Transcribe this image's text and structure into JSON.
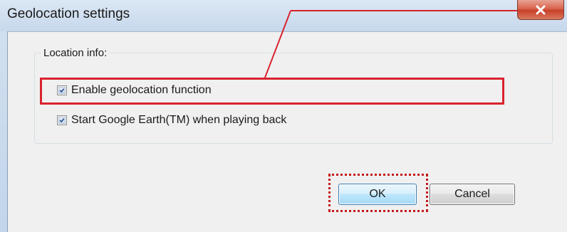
{
  "window": {
    "title": "Geolocation settings",
    "close_icon": "close-icon"
  },
  "group": {
    "label": "Location info:"
  },
  "options": [
    {
      "label": "Enable geolocation function",
      "checked": true
    },
    {
      "label": "Start Google Earth(TM) when playing back",
      "checked": true
    }
  ],
  "buttons": {
    "ok_label": "OK",
    "cancel_label": "Cancel"
  },
  "colors": {
    "highlight": "#d9232e",
    "check": "#2a4f8f"
  }
}
